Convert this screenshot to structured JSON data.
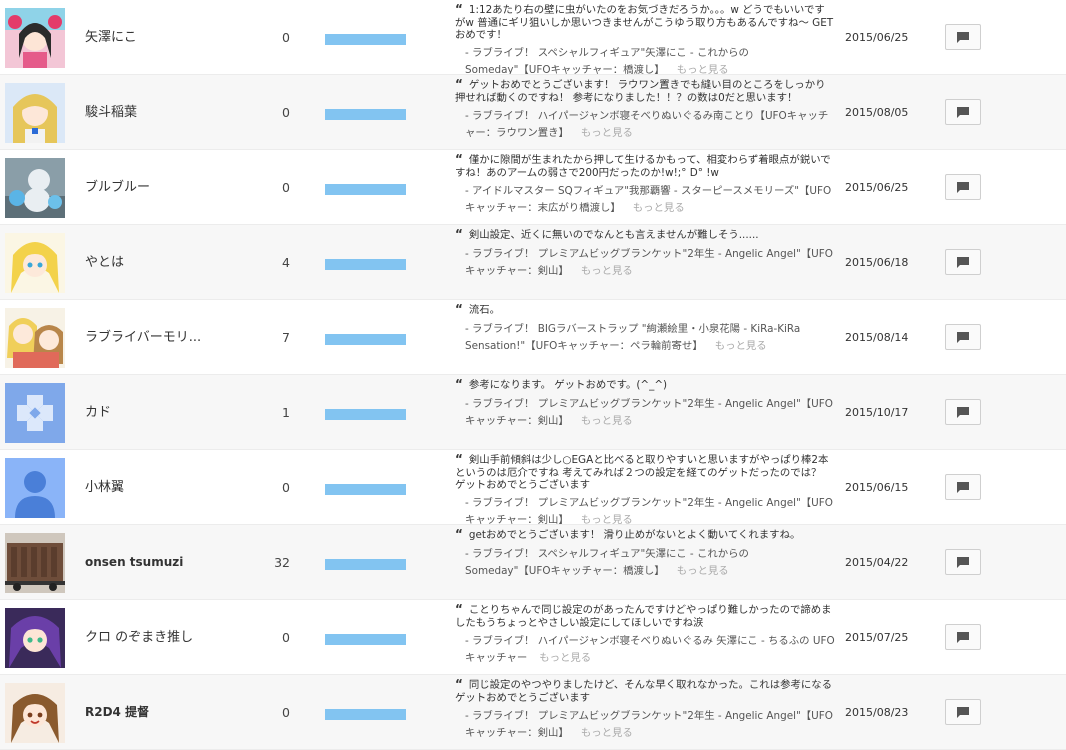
{
  "rows": [
    {
      "user": "矢澤にこ",
      "count": "0",
      "review": "1:12あたり右の壁に虫がいたのをお気づきだろうか。。。w どうでもいいですがw 普通にギリ狙いしか思いつきませんがこうゆう取り方もあるんですね～ GETおめです！",
      "product": "- ラブライブ！ スペシャルフィギュア\"矢澤にこ - これからの Someday\"【UFOキャッチャー：橋渡し】",
      "more": "もっと見る",
      "date": "2015/06/25",
      "avatar": "anime-pink"
    },
    {
      "user": "駿斗稲葉",
      "count": "0",
      "review": "ゲットおめでとうございます！ ラウワン置きでも縫い目のところをしっかり押せれば動くのですね！ 参考になりました！！？の数は0だと思います！",
      "product": "- ラブライブ！ ハイパージャンボ寝そべりぬいぐるみ南ことり【UFOキャッチャー：ラウワン置き】",
      "more": "もっと見る",
      "date": "2015/08/05",
      "avatar": "anime-blonde"
    },
    {
      "user": "ブルブルー",
      "count": "0",
      "review": "僅かに隙間が生まれたから押して生けるかもって、相変わらず着眼点が鋭いですね！あのアームの弱さで200円だったのか!w!;° D° !w",
      "product": "- アイドルマスター SQフィギュア\"我那覇響 - スターピースメモリーズ\"【UFOキャッチャー：末広がり橋渡し】",
      "more": "もっと見る",
      "date": "2015/06/25",
      "avatar": "figure"
    },
    {
      "user": "やとは",
      "count": "4",
      "review": "剣山設定、近くに無いのでなんとも言えませんが難しそう......",
      "product": "- ラブライブ！ プレミアムビッグブランケット\"2年生 - Angelic Angel\"【UFOキャッチャー：剣山】",
      "more": "もっと見る",
      "date": "2015/06/18",
      "avatar": "anime-yellow"
    },
    {
      "user": "ラブライバーモリ...",
      "count": "7",
      "review": "流石。",
      "product": "- ラブライブ！ BIGラバーストラップ \"絢瀬絵里・小泉花陽 - KiRa-KiRa Sensation!\"【UFOキャッチャー：ペラ輪前寄せ】",
      "more": "もっと見る",
      "date": "2015/08/14",
      "avatar": "anime-duo"
    },
    {
      "user": "カド",
      "count": "1",
      "review": "参考になります。 ゲットおめです。(^_^)",
      "product": "- ラブライブ！ プレミアムビッグブランケット\"2年生 - Angelic Angel\"【UFOキャッチャー：剣山】",
      "more": "もっと見る",
      "date": "2015/10/17",
      "avatar": "pattern"
    },
    {
      "user": "小林翼",
      "count": "0",
      "review": "剣山手前傾斜は少し○EGAと比べると取りやすいと思いますがやっぱり棒2本というのは厄介ですね 考えてみれば２つの設定を経てのゲットだったのでは？ ゲットおめでとうございます",
      "product": "- ラブライブ！ プレミアムビッグブランケット\"2年生 - Angelic Angel\"【UFOキャッチャー：剣山】",
      "more": "もっと見る",
      "date": "2015/06/15",
      "avatar": "default"
    },
    {
      "user": "onsen tsumuzi",
      "count": "32",
      "review": "getおめでとうございます！ 滑り止めがないとよく動いてくれますね。",
      "product": "- ラブライブ！ スペシャルフィギュア\"矢澤にこ - これからの Someday\"【UFOキャッチャー：橋渡し】",
      "more": "もっと見る",
      "date": "2015/04/22",
      "avatar": "train"
    },
    {
      "user": "クロ のぞまき推し",
      "count": "0",
      "review": "ことりちゃんで同じ設定のがあったんですけどやっぱり難しかったので諦めましたもうちょっとやさしい設定にしてほしいですね涙",
      "product": "- ラブライブ！ ハイパージャンボ寝そべりぬいぐるみ 矢澤にこ - ちるふの UFOキャッチャー",
      "more": "もっと見る",
      "date": "2015/07/25",
      "avatar": "anime-purple"
    },
    {
      "user": "R2D4 提督",
      "count": "0",
      "review": "同じ設定のやつやりましたけど、そんな早く取れなかった。これは参考になるゲットおめでとうございます",
      "product": "- ラブライブ！ プレミアムビッグブランケット\"2年生 - Angelic Angel\"【UFOキャッチャー：剣山】",
      "more": "もっと見る",
      "date": "2015/08/23",
      "avatar": "anime-brown"
    }
  ],
  "colors": {
    "bar": "#82c4f1",
    "default_avatar_bg": "#8ab4f8",
    "default_avatar_fg": "#4a7fd8"
  }
}
